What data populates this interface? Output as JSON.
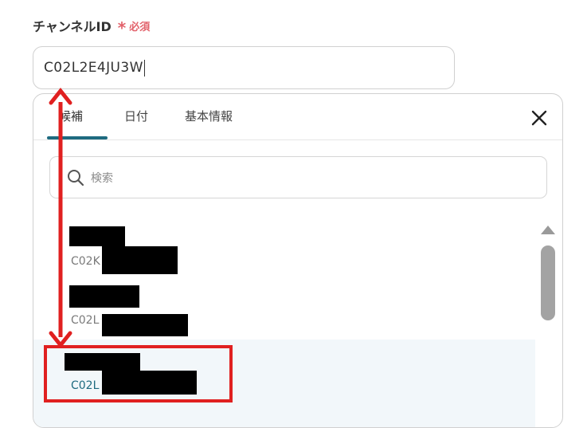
{
  "field": {
    "label": "チャンネルID",
    "required_mark": "*",
    "required_text": "必須",
    "value": "C02L2E4JU3W"
  },
  "dropdown": {
    "tabs": [
      {
        "label": "候補",
        "active": true
      },
      {
        "label": "日付",
        "active": false
      },
      {
        "label": "基本情報",
        "active": false
      }
    ],
    "close_icon": "close-icon",
    "search": {
      "icon": "search-icon",
      "placeholder": "検索"
    },
    "items": [
      {
        "name": "",
        "id_prefix": "C02K",
        "redacted": true,
        "selected": false
      },
      {
        "name": "",
        "id_prefix": "C02L",
        "redacted": true,
        "selected": false
      },
      {
        "name": "",
        "id_prefix": "C02L",
        "redacted": true,
        "selected": true
      }
    ]
  },
  "colors": {
    "accent": "#1e6b80",
    "required": "#e2626b",
    "annotation": "#e02020",
    "selected_bg": "#f2f7fa"
  }
}
